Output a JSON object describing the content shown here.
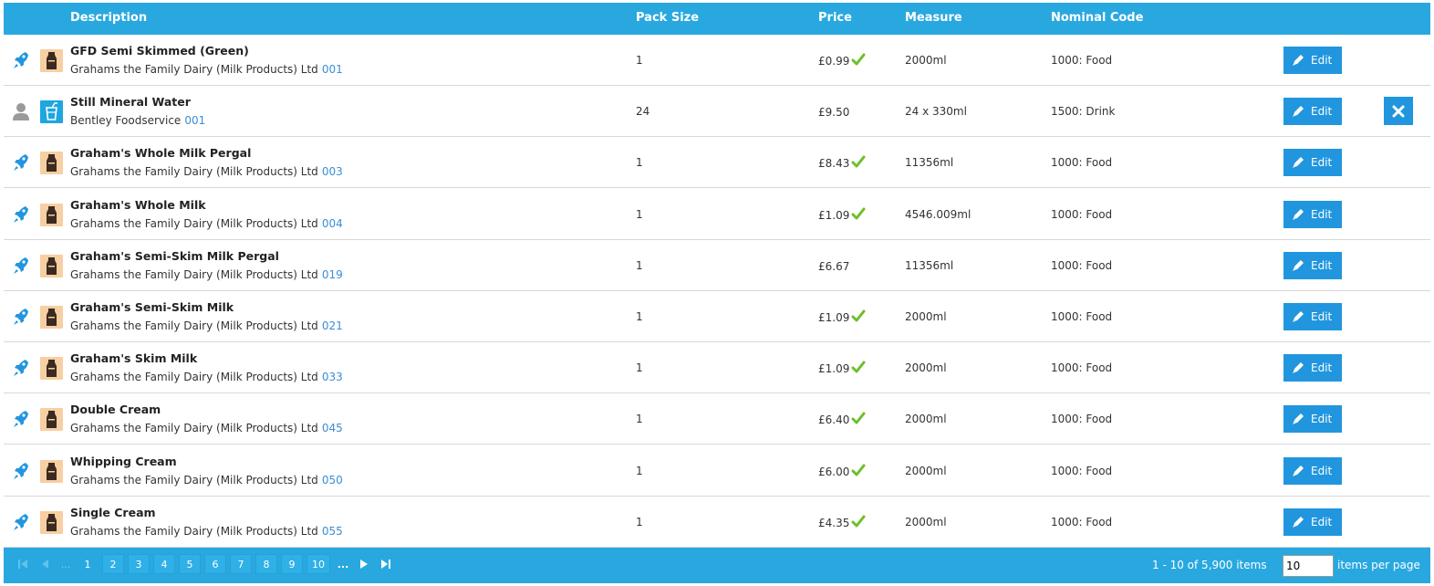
{
  "headers": {
    "description": "Description",
    "pack_size": "Pack Size",
    "price": "Price",
    "measure": "Measure",
    "nominal_code": "Nominal Code"
  },
  "edit_label": "Edit",
  "rows": [
    {
      "title": "GFD Semi Skimmed (Green)",
      "supplier": "Grahams the Family Dairy (Milk Products) Ltd",
      "code": "001",
      "pack_size": "1",
      "price": "£0.99",
      "checked": true,
      "measure": "2000ml",
      "nominal": "1000: Food",
      "source_icon": "rocket-icon",
      "category_icon": "milk-bottle-icon",
      "deletable": false
    },
    {
      "title": "Still Mineral Water",
      "supplier": "Bentley Foodservice",
      "code": "001",
      "pack_size": "24",
      "price": "£9.50",
      "checked": false,
      "measure": "24 x 330ml",
      "nominal": "1500: Drink",
      "source_icon": "user-icon",
      "category_icon": "drink-cup-icon",
      "deletable": true
    },
    {
      "title": "Graham's Whole Milk Pergal",
      "supplier": "Grahams the Family Dairy (Milk Products) Ltd",
      "code": "003",
      "pack_size": "1",
      "price": "£8.43",
      "checked": true,
      "measure": "11356ml",
      "nominal": "1000: Food",
      "source_icon": "rocket-icon",
      "category_icon": "milk-bottle-icon",
      "deletable": false
    },
    {
      "title": "Graham's Whole Milk",
      "supplier": "Grahams the Family Dairy (Milk Products) Ltd",
      "code": "004",
      "pack_size": "1",
      "price": "£1.09",
      "checked": true,
      "measure": "4546.009ml",
      "nominal": "1000: Food",
      "source_icon": "rocket-icon",
      "category_icon": "milk-bottle-icon",
      "deletable": false
    },
    {
      "title": "Graham's Semi-Skim Milk Pergal",
      "supplier": "Grahams the Family Dairy (Milk Products) Ltd",
      "code": "019",
      "pack_size": "1",
      "price": "£6.67",
      "checked": false,
      "measure": "11356ml",
      "nominal": "1000: Food",
      "source_icon": "rocket-icon",
      "category_icon": "milk-bottle-icon",
      "deletable": false
    },
    {
      "title": "Graham's Semi-Skim Milk",
      "supplier": "Grahams the Family Dairy (Milk Products) Ltd",
      "code": "021",
      "pack_size": "1",
      "price": "£1.09",
      "checked": true,
      "measure": "2000ml",
      "nominal": "1000: Food",
      "source_icon": "rocket-icon",
      "category_icon": "milk-bottle-icon",
      "deletable": false
    },
    {
      "title": "Graham's Skim Milk",
      "supplier": "Grahams the Family Dairy (Milk Products) Ltd",
      "code": "033",
      "pack_size": "1",
      "price": "£1.09",
      "checked": true,
      "measure": "2000ml",
      "nominal": "1000: Food",
      "source_icon": "rocket-icon",
      "category_icon": "milk-bottle-icon",
      "deletable": false
    },
    {
      "title": "Double Cream",
      "supplier": "Grahams the Family Dairy (Milk Products) Ltd",
      "code": "045",
      "pack_size": "1",
      "price": "£6.40",
      "checked": true,
      "measure": "2000ml",
      "nominal": "1000: Food",
      "source_icon": "rocket-icon",
      "category_icon": "milk-bottle-icon",
      "deletable": false
    },
    {
      "title": "Whipping Cream",
      "supplier": "Grahams the Family Dairy (Milk Products) Ltd",
      "code": "050",
      "pack_size": "1",
      "price": "£6.00",
      "checked": true,
      "measure": "2000ml",
      "nominal": "1000: Food",
      "source_icon": "rocket-icon",
      "category_icon": "milk-bottle-icon",
      "deletable": false
    },
    {
      "title": "Single Cream",
      "supplier": "Grahams the Family Dairy (Milk Products) Ltd",
      "code": "055",
      "pack_size": "1",
      "price": "£4.35",
      "checked": true,
      "measure": "2000ml",
      "nominal": "1000: Food",
      "source_icon": "rocket-icon",
      "category_icon": "milk-bottle-icon",
      "deletable": false
    }
  ],
  "pager": {
    "pages": [
      "1",
      "2",
      "3",
      "4",
      "5",
      "6",
      "7",
      "8",
      "9",
      "10"
    ],
    "current_page": "1",
    "ellipsis_before": "...",
    "ellipsis_after": "...",
    "info": "1 - 10 of 5,900 items",
    "page_size": "10",
    "page_size_label": "items per page"
  },
  "colors": {
    "header_bg": "#29a8e0",
    "button_bg": "#2196de",
    "check_green": "#6cbf2a",
    "code_link": "#3a8ed4",
    "milk_tile": "#f7cfa2",
    "water_tile": "#1ea6e0"
  }
}
